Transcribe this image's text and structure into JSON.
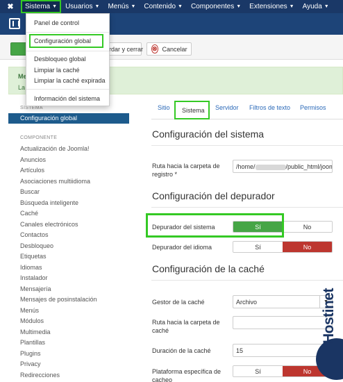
{
  "navbar": {
    "logo": "✖",
    "items": [
      {
        "label": "Sistema"
      },
      {
        "label": "Usuarios"
      },
      {
        "label": "Menús"
      },
      {
        "label": "Contenido"
      },
      {
        "label": "Componentes"
      },
      {
        "label": "Extensiones"
      },
      {
        "label": "Ayuda"
      }
    ]
  },
  "dropdown": {
    "items": [
      "Panel de control",
      "Configuración global",
      "Desbloqueo global",
      "Limpiar la caché",
      "Limpiar la caché expirada",
      "Información del sistema"
    ]
  },
  "toolbar": {
    "save_close_label": "rdar y cerrar",
    "cancel_label": "Cancelar"
  },
  "message": {
    "title": "Me",
    "text": "La"
  },
  "sidebar": {
    "system_header": "SISTEMA",
    "active_item": "Configuración global",
    "component_header": "COMPONENTE",
    "items": [
      "Actualización de Joomla!",
      "Anuncios",
      "Artículos",
      "Asociaciones multiidioma",
      "Buscar",
      "Búsqueda inteligente",
      "Caché",
      "Canales electrónicos",
      "Contactos",
      "Desbloqueo",
      "Etiquetas",
      "Idiomas",
      "Instalador",
      "Mensajería",
      "Mensajes de posinstalación",
      "Menús",
      "Módulos",
      "Multimedia",
      "Plantillas",
      "Plugins",
      "Privacy",
      "Redirecciones"
    ]
  },
  "tabs": [
    "Sitio",
    "Sistema",
    "Servidor",
    "Filtros de texto",
    "Permisos"
  ],
  "sections": {
    "system": {
      "title": "Configuración del sistema",
      "log_path_label": "Ruta hacia la carpeta de registro *",
      "log_path_prefix": "/home/",
      "log_path_suffix": "/public_html/joomla"
    },
    "debug": {
      "title": "Configuración del depurador",
      "system_debug_label": "Depurador del sistema",
      "language_debug_label": "Depurador del idioma",
      "yes": "Sí",
      "no": "No"
    },
    "cache": {
      "title": "Configuración de la caché",
      "handler_label": "Gestor de la caché",
      "handler_value": "Archivo",
      "path_label": "Ruta hacia la carpeta de caché",
      "path_value": "",
      "time_label": "Duración de la caché",
      "time_value": "15",
      "platform_label": "Plataforma específica de cacheo",
      "yes": "Sí",
      "no": "No"
    }
  },
  "watermark": "Hostinet",
  "colors": {
    "navbar": "#1a3867",
    "highlight": "#34c924",
    "yes_active": "#46a546",
    "no_active": "#bd362f",
    "sidebar_active": "#1d5b8c",
    "link": "#2a69b8"
  }
}
